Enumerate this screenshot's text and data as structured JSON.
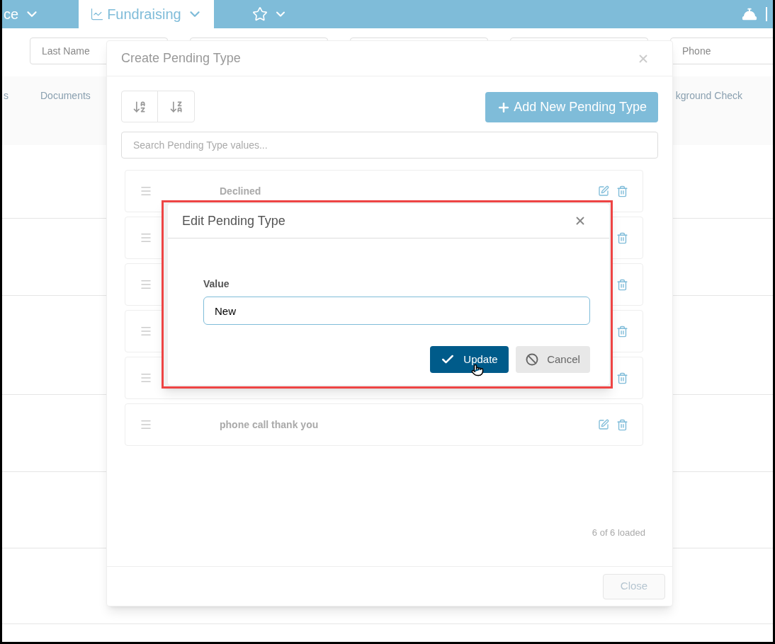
{
  "nav": {
    "tabs": [
      {
        "label": "ce",
        "selected": false,
        "kind": "plain"
      },
      {
        "label": "Fundraising",
        "selected": true,
        "kind": "chart"
      }
    ]
  },
  "filters": [
    {
      "placeholder": "Last Name",
      "kind": "shown"
    },
    {
      "kind": "covered"
    },
    {
      "kind": "covered"
    },
    {
      "kind": "covered"
    },
    {
      "placeholder": "Phone",
      "kind": "shown"
    }
  ],
  "columns": [
    "s",
    "Documents",
    "kground Check"
  ],
  "dialog": {
    "title": "Create Pending Type",
    "add_button": "Add New Pending Type",
    "search": {
      "placeholder": "Search Pending Type values..."
    },
    "items": [
      {
        "label": "Declined",
        "kind": "shown"
      },
      {
        "kind": "covered"
      },
      {
        "kind": "covered"
      },
      {
        "kind": "covered"
      },
      {
        "kind": "covered"
      },
      {
        "label": "phone call thank you",
        "kind": "shown"
      }
    ],
    "count": "6 of 6 loaded",
    "close_button": {
      "label": "Close",
      "disabled": true
    }
  },
  "edit_dialog": {
    "title": "Edit Pending Type",
    "field_label": "Value",
    "value": "New",
    "update_button": "Update",
    "cancel_button": "Cancel"
  }
}
